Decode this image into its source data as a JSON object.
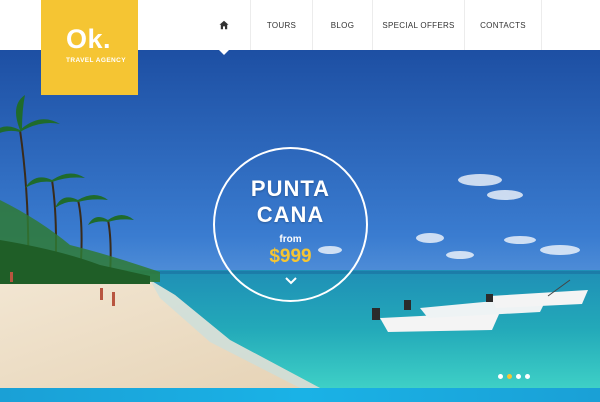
{
  "brand": {
    "logo_mark": "Ok.",
    "tagline": "TRAVEL AGENCY",
    "accent": "#f5c533"
  },
  "nav": {
    "home_icon": "home-icon",
    "items": [
      {
        "label": "TOURS"
      },
      {
        "label": "BLOG"
      },
      {
        "label": "SPECIAL OFFERS"
      },
      {
        "label": "CONTACTS"
      }
    ]
  },
  "hero": {
    "title_line1": "PUNTA",
    "title_line2": "CANA",
    "from_label": "from",
    "price": "$999",
    "arrow_icon": "chevron-down-icon"
  },
  "slider": {
    "slides": 4,
    "active_index": 1
  }
}
